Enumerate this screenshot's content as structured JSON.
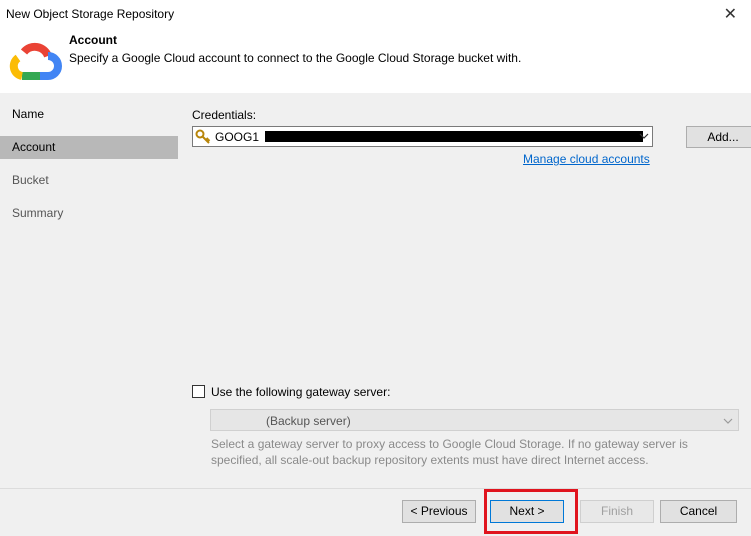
{
  "window": {
    "title": "New Object Storage Repository",
    "close_glyph": "✕"
  },
  "header": {
    "title": "Account",
    "subtitle": "Specify a Google Cloud account to connect to the Google Cloud Storage bucket with.",
    "logo_icon": "google-cloud-icon"
  },
  "sidebar": {
    "items": [
      {
        "label": "Name",
        "active": false
      },
      {
        "label": "Account",
        "active": true
      },
      {
        "label": "Bucket",
        "active": false
      },
      {
        "label": "Summary",
        "active": false
      }
    ]
  },
  "credentials": {
    "label": "Credentials:",
    "selected_value": "GOOG1",
    "key_icon": "key-icon",
    "add_button": "Add...",
    "manage_link": "Manage cloud accounts"
  },
  "gateway": {
    "checkbox_label": "Use the following gateway server:",
    "checked": false,
    "selected_value": "(Backup server)",
    "description": "Select a gateway server to proxy access to Google Cloud Storage. If no gateway server is specified, all scale-out backup repository extents must have direct Internet access."
  },
  "footer": {
    "previous": "< Previous",
    "next": "Next >",
    "finish": "Finish",
    "cancel": "Cancel"
  },
  "colors": {
    "highlight": "#e0141e",
    "link": "#0066cc",
    "sidebar_active": "#b8b8b8"
  }
}
